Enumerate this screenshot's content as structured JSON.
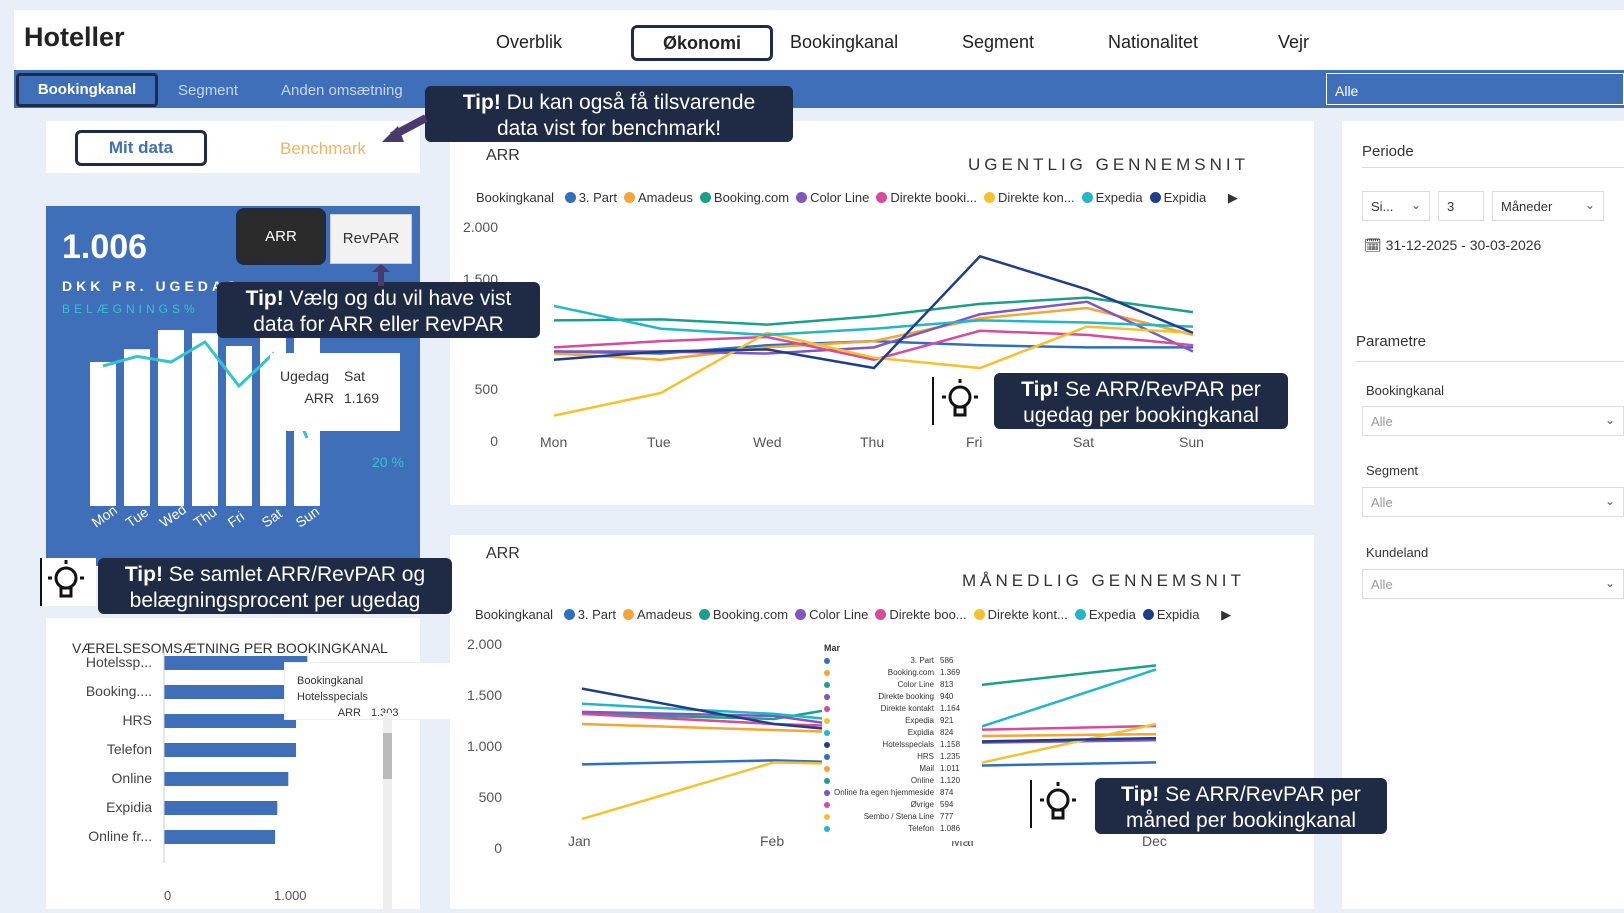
{
  "app": {
    "title": "Hoteller"
  },
  "nav": {
    "items": [
      "Overblik",
      "Økonomi",
      "Bookingkanal",
      "Segment",
      "Nationalitet",
      "Vejr"
    ]
  },
  "subnav": {
    "items": [
      "Bookingkanal",
      "Segment",
      "Anden omsætning"
    ],
    "filter_value": "Alle"
  },
  "toggle": {
    "mine": "Mit data",
    "benchmark": "Benchmark"
  },
  "kpi_card": {
    "value": "1.006",
    "unit": "DKK PR. UGEDAG",
    "sub": "BELÆGNINGS%",
    "btn_arr": "ARR",
    "btn_revpar": "RevPAR",
    "tooltip_k1": "Ugedag",
    "tooltip_v1": "Sat",
    "tooltip_k2": "ARR",
    "tooltip_v2": "1.169",
    "pct_label": "20 %",
    "days": [
      "Mon",
      "Tue",
      "Wed",
      "Thu",
      "Fri",
      "Sat",
      "Sun"
    ]
  },
  "tips": {
    "t1_bold": "Tip!",
    "t1_rest": " Du kan også få tilsvarende",
    "t1_line2": "data vist for benchmark!",
    "t2_bold": "Tip!",
    "t2_rest": " Vælg og du vil have vist",
    "t2_line2": "data for ARR eller RevPAR",
    "t3_bold": "Tip!",
    "t3_rest": " Se samlet ARR/RevPAR og",
    "t3_line2": "belægningsprocent per ugedag",
    "t4_bold": "Tip!",
    "t4_rest": " Se ARR/RevPAR per",
    "t4_line2": "ugedag per bookingkanal",
    "t5_bold": "Tip!",
    "t5_rest": " Se ARR/RevPAR per",
    "t5_line2": "måned per bookingkanal"
  },
  "bar_panel": {
    "title": "VÆRELSESOMSÆTNING PER BOOKINGKANAL",
    "tooltip_h1": "Bookingkanal",
    "tooltip_h2": "Hotelsspecials",
    "tooltip_k": "ARR",
    "tooltip_v": "1.303",
    "xticks": [
      "0",
      "1.000"
    ]
  },
  "weekly": {
    "label": "ARR",
    "title": "UGENTLIG GENNEMSNIT",
    "legend_title": "Bookingkanal",
    "legend": [
      "3. Part",
      "Amadeus",
      "Booking.com",
      "Color Line",
      "Direkte booki...",
      "Direkte kon...",
      "Expedia",
      "Expidia"
    ],
    "yticks": [
      "2.000",
      "1.500",
      "500",
      "0"
    ],
    "xticks": [
      "Mon",
      "Tue",
      "Wed",
      "Thu",
      "Fri",
      "Sat",
      "Sun"
    ]
  },
  "monthly": {
    "label": "ARR",
    "title": "MÅNEDLIG GENNEMSNIT",
    "legend_title": "Bookingkanal",
    "legend": [
      "3. Part",
      "Amadeus",
      "Booking.com",
      "Color Line",
      "Direkte boo...",
      "Direkte kont...",
      "Expedia",
      "Expidia"
    ],
    "yticks": [
      "2.000",
      "1.500",
      "1.000",
      "500",
      "0"
    ],
    "xticks": [
      "Jan",
      "Feb",
      "Mar",
      "Dec"
    ],
    "tooltip_title": "Mar",
    "tooltip_rows": [
      {
        "k": "3. Part",
        "v": "586"
      },
      {
        "k": "Booking.com",
        "v": "1.369"
      },
      {
        "k": "Color Line",
        "v": "813"
      },
      {
        "k": "Direkte booking",
        "v": "940"
      },
      {
        "k": "Direkte kontakt",
        "v": "1.164"
      },
      {
        "k": "Expedia",
        "v": "921"
      },
      {
        "k": "Expidia",
        "v": "824"
      },
      {
        "k": "Hotelsspecials",
        "v": "1.158"
      },
      {
        "k": "HRS",
        "v": "1.235"
      },
      {
        "k": "Mail",
        "v": "1.011"
      },
      {
        "k": "Online",
        "v": "1.120"
      },
      {
        "k": "Online fra egen hjemmeside",
        "v": "874"
      },
      {
        "k": "Øvrige",
        "v": "594"
      },
      {
        "k": "Sembo / Stena Line",
        "v": "777"
      },
      {
        "k": "Telefon",
        "v": "1.086"
      }
    ]
  },
  "right_panel": {
    "periode_label": "Periode",
    "sel1": "Si...",
    "sel2": "3",
    "sel3": "Måneder",
    "date_range": "31-12-2025 - 30-03-2026",
    "parametre_label": "Parametre",
    "f1_label": "Bookingkanal",
    "f1_value": "Alle",
    "f2_label": "Segment",
    "f2_value": "Alle",
    "f3_label": "Kundeland",
    "f3_value": "Alle"
  },
  "colors": {
    "accent": "#3f6fb9",
    "dark": "#1f2a45",
    "series": [
      "#2f6fbf",
      "#f4a534",
      "#1aa08a",
      "#7e57c2",
      "#d94a9a",
      "#f6c12e",
      "#20b7c8",
      "#1e3e8c"
    ]
  },
  "chart_data": [
    {
      "type": "bar",
      "title": "VÆRELSESOMSÆTNING PER BOOKINGKANAL",
      "categories": [
        "Hotelssp...",
        "Booking....",
        "HRS",
        "Telefon",
        "Online",
        "Expidia",
        "Online fr..."
      ],
      "values": [
        1303,
        1270,
        1200,
        1200,
        1130,
        1030,
        1010
      ],
      "xlim": [
        0,
        1900
      ]
    },
    {
      "type": "bar",
      "title": "",
      "categories": [
        "Mon",
        "Tue",
        "Wed",
        "Thu",
        "Fri",
        "Sat",
        "Sun"
      ],
      "values": [
        900,
        980,
        1100,
        1080,
        1000,
        1169,
        1100
      ],
      "ylim": [
        0,
        1500
      ]
    },
    {
      "type": "line",
      "title": "UGENTLIG GENNEMSNIT",
      "ylabel": "ARR",
      "x": [
        "Mon",
        "Tue",
        "Wed",
        "Thu",
        "Fri",
        "Sat",
        "Sun"
      ],
      "ylim": [
        0,
        2000
      ],
      "series": [
        {
          "name": "3. Part",
          "values": [
            720,
            700,
            780,
            820,
            780,
            760,
            760
          ]
        },
        {
          "name": "Amadeus",
          "values": [
            700,
            640,
            760,
            820,
            1040,
            1140,
            880
          ]
        },
        {
          "name": "Booking.com",
          "values": [
            1020,
            1030,
            980,
            1060,
            1180,
            1240,
            1100
          ]
        },
        {
          "name": "Color Line",
          "values": [
            720,
            720,
            700,
            760,
            1080,
            1200,
            720
          ]
        },
        {
          "name": "Direkte booki...",
          "values": [
            760,
            820,
            860,
            640,
            920,
            880,
            780
          ]
        },
        {
          "name": "Direkte kon...",
          "values": [
            100,
            320,
            900,
            660,
            560,
            960,
            900
          ]
        },
        {
          "name": "Expedia",
          "values": [
            1160,
            940,
            880,
            940,
            1020,
            1000,
            960
          ]
        },
        {
          "name": "Expidia",
          "values": [
            640,
            720,
            740,
            560,
            1640,
            1320,
            900
          ]
        }
      ]
    },
    {
      "type": "line",
      "title": "MÅNEDLIG GENNEMSNIT",
      "ylabel": "ARR",
      "x": [
        "Jan",
        "Feb",
        "Mar",
        "Dec"
      ],
      "ylim": [
        0,
        2000
      ],
      "series": [
        {
          "name": "3. Part",
          "values": [
            600,
            640,
            586,
            620
          ]
        },
        {
          "name": "Amadeus",
          "values": [
            1000,
            940,
            880,
            900
          ]
        },
        {
          "name": "Booking.com",
          "values": [
            1100,
            1050,
            1369,
            1580
          ]
        },
        {
          "name": "Color Line",
          "values": [
            1120,
            1080,
            813,
            840
          ]
        },
        {
          "name": "Direkte boo...",
          "values": [
            1100,
            1000,
            940,
            980
          ]
        },
        {
          "name": "Direkte kont...",
          "values": [
            60,
            620,
            580,
            1000
          ]
        },
        {
          "name": "Expedia",
          "values": [
            1200,
            1100,
            921,
            1540
          ]
        },
        {
          "name": "Expidia",
          "values": [
            1350,
            1000,
            824,
            860
          ]
        }
      ]
    }
  ]
}
